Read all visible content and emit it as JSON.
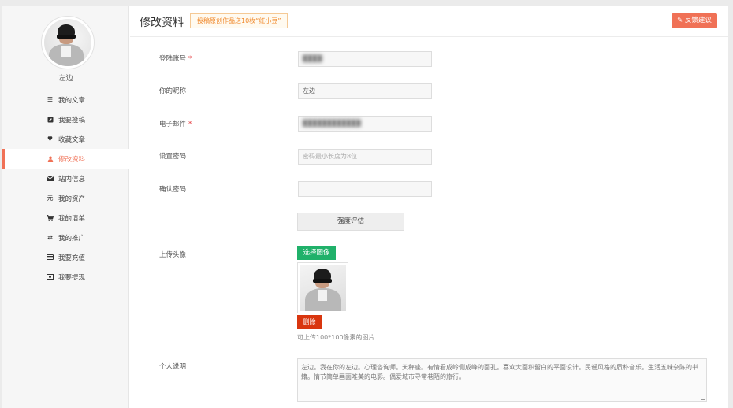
{
  "sidebar": {
    "username": "左边",
    "items": [
      {
        "label": "我的文章",
        "icon": "list-icon"
      },
      {
        "label": "我要投稿",
        "icon": "edit-icon"
      },
      {
        "label": "收藏文章",
        "icon": "heart-icon"
      },
      {
        "label": "修改资料",
        "icon": "user-icon",
        "active": true
      },
      {
        "label": "站内信息",
        "icon": "envelope-icon"
      },
      {
        "label": "我的资产",
        "icon": "yuan-icon"
      },
      {
        "label": "我的清单",
        "icon": "cart-icon"
      },
      {
        "label": "我的推广",
        "icon": "shuffle-icon"
      },
      {
        "label": "我要充值",
        "icon": "credit-card-icon"
      },
      {
        "label": "我要提现",
        "icon": "money-icon"
      }
    ]
  },
  "header": {
    "title": "修改资料",
    "notice": "投稿原创作品送10枚“红小豆”",
    "feedback_label": "反馈建议"
  },
  "form": {
    "account_label": "登陆账号",
    "account_value": "████",
    "nickname_label": "你的昵称",
    "nickname_value": "左边",
    "email_label": "电子邮件",
    "email_value": "████████████",
    "password_label": "设置密码",
    "password_placeholder": "密码最小长度为8位",
    "confirm_label": "确认密码",
    "confirm_value": "",
    "required_mark": "*",
    "strength_label": "强度评估",
    "avatar_label": "上传头像",
    "choose_label": "选择图像",
    "delete_label": "删除",
    "avatar_hint": "可上传100*100像素的图片",
    "bio_label": "个人说明",
    "bio_value": "左边。我在你的左边。心理咨询师。天秤座。有情看成岭侧成峰的面孔。喜欢大面积留白的平面设计。民谣风格的质朴音乐。生活五味杂陈的书籍。情节简单画面唯美的电影。偶爱城市寻常巷陌的旅行。"
  },
  "colors": {
    "accent": "#f07156",
    "success": "#20b16a",
    "danger": "#d9360f",
    "notice": "#f0892c"
  }
}
